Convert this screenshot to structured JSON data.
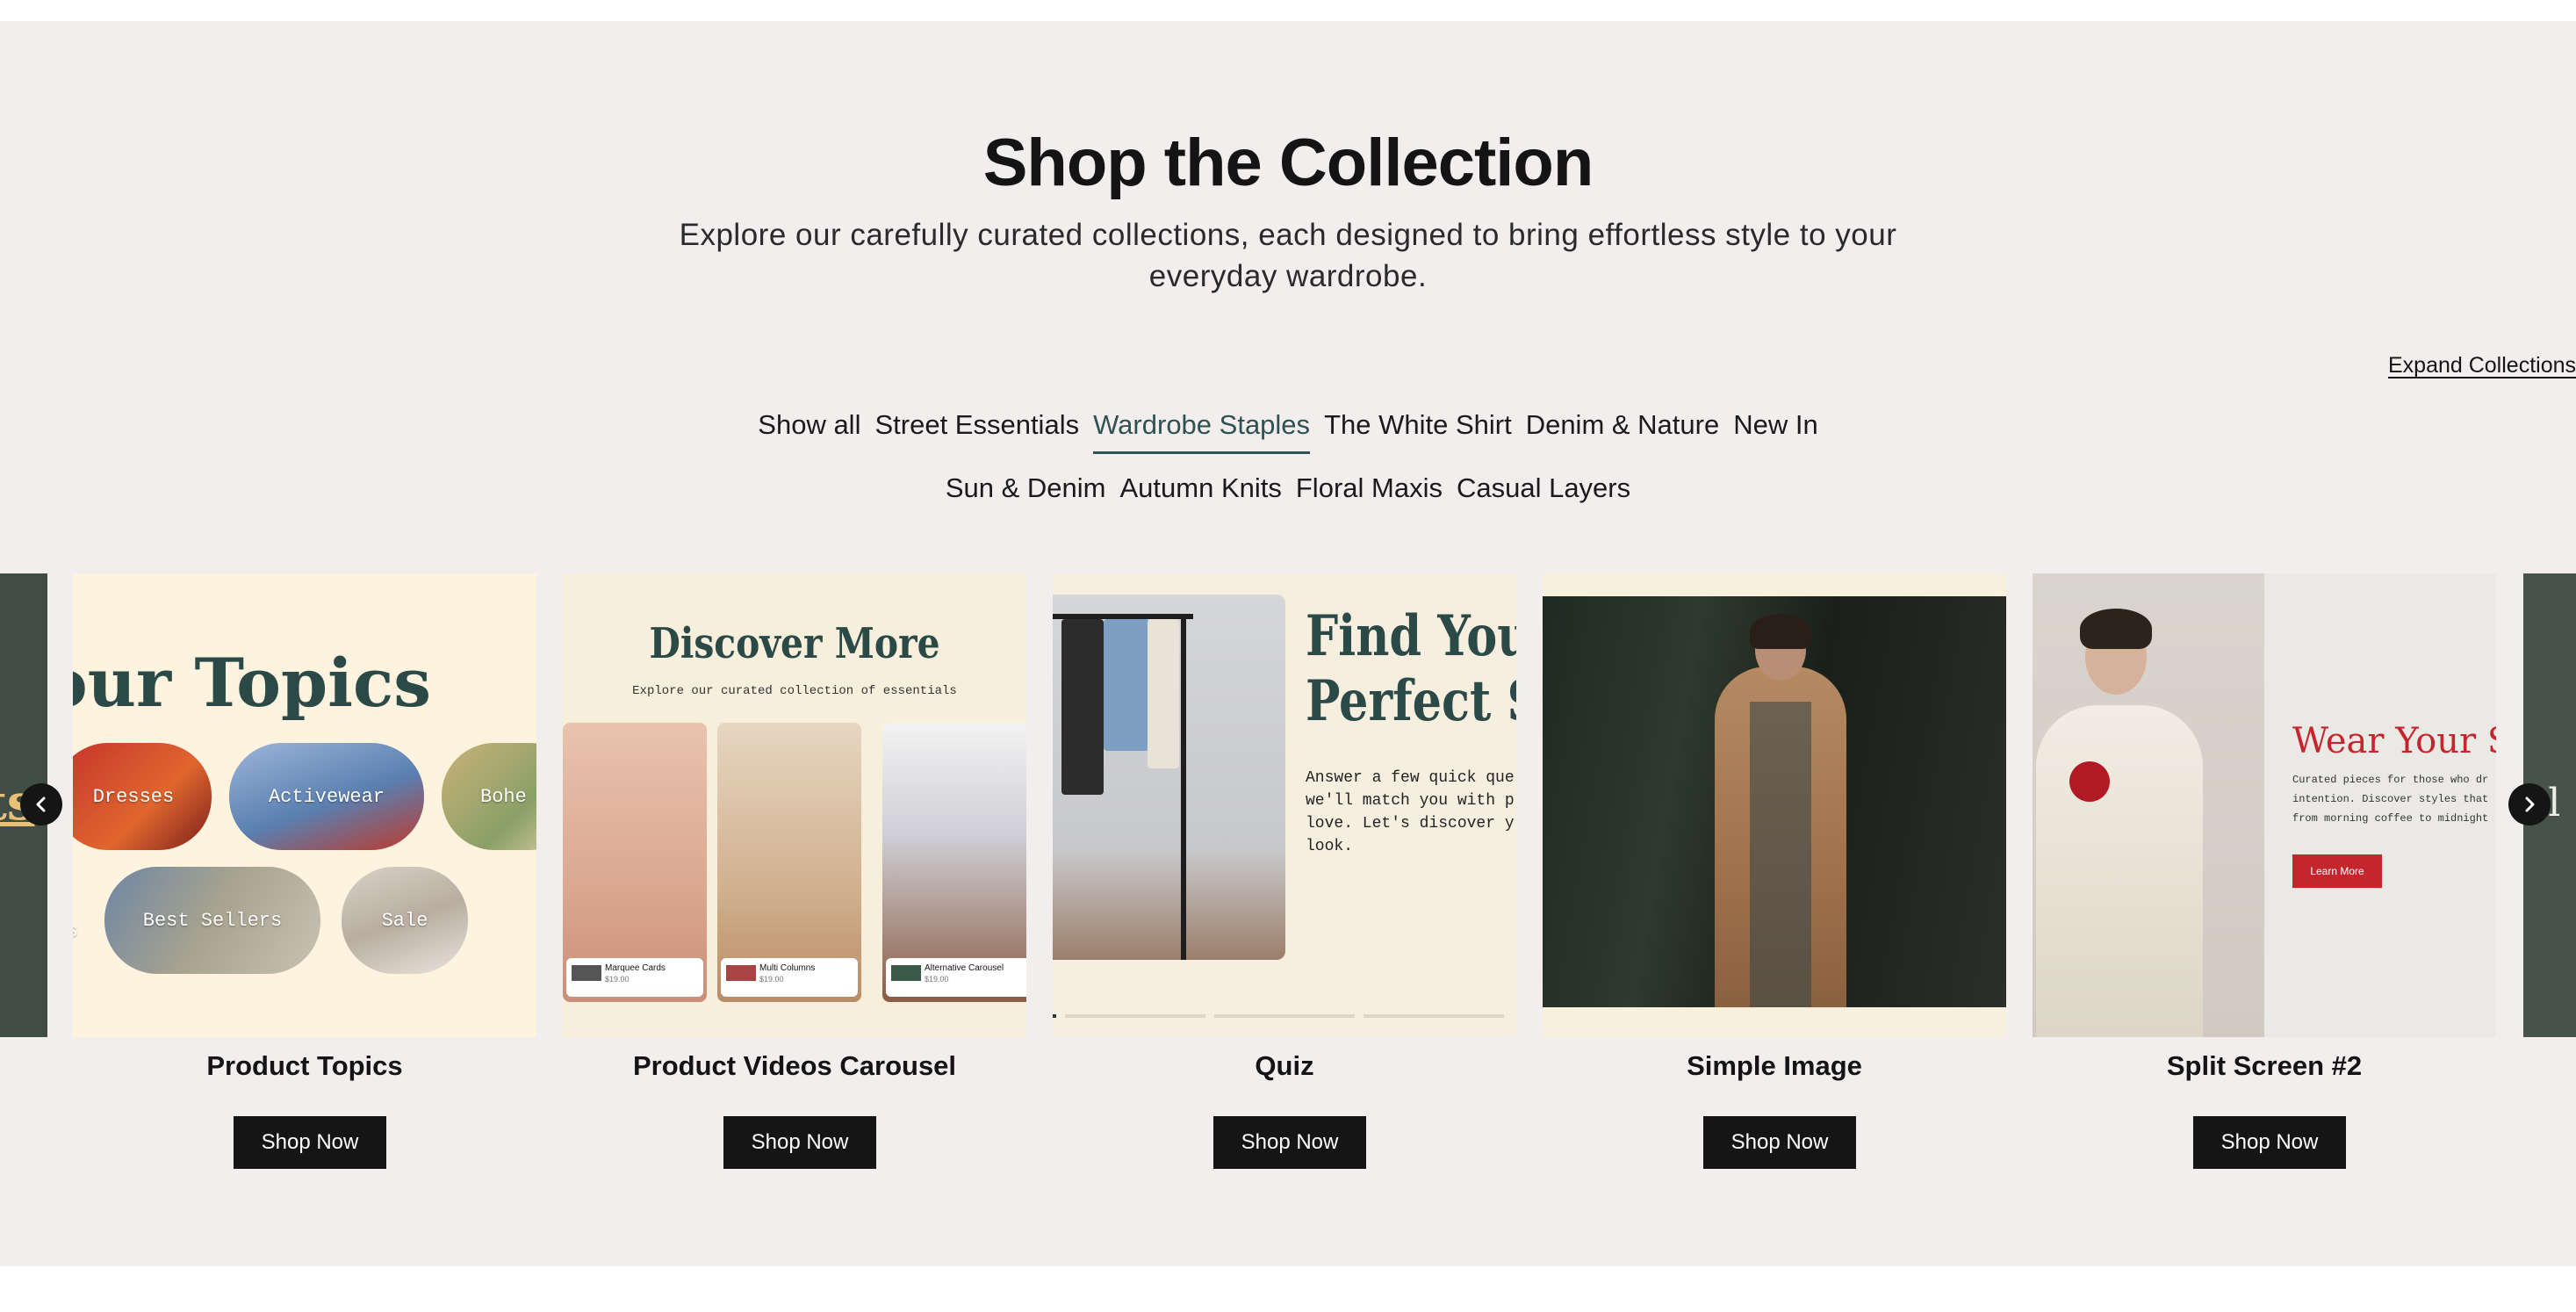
{
  "header": {
    "title": "Shop the Collection",
    "subtitle": "Explore our carefully curated collections, each designed to bring effortless style to your everyday wardrobe.",
    "expand_link": "Expand Collections"
  },
  "filters": {
    "row1": [
      "Show all",
      "Street Essentials",
      "Wardrobe Staples",
      "The White Shirt",
      "Denim & Nature",
      "New In"
    ],
    "row2": [
      "Sun & Denim",
      "Autumn Knits",
      "Floral Maxis",
      "Casual Layers"
    ],
    "active": "Wardrobe Staples"
  },
  "cards": [
    {
      "title": "Product Topics",
      "button": "Shop Now"
    },
    {
      "title": "Product Videos Carousel",
      "button": "Shop Now"
    },
    {
      "title": "Quiz",
      "button": "Shop Now"
    },
    {
      "title": "Simple Image",
      "button": "Shop Now"
    },
    {
      "title": "Split Screen #2",
      "button": "Shop Now"
    }
  ],
  "previews": {
    "topics": {
      "heading": "our Topics",
      "pills": [
        "Dresses",
        "Activewear",
        "Bohe",
        "Best Sellers",
        "Sale"
      ],
      "left_partial": "ts"
    },
    "videos": {
      "heading": "Discover More",
      "sub": "Explore our curated collection of essentials",
      "items": [
        {
          "name": "Marquee Cards",
          "price": "$19.00"
        },
        {
          "name": "Multi Columns",
          "price": "$19.00"
        },
        {
          "name": "Alternative Carousel",
          "price": "$19.00"
        }
      ]
    },
    "quiz": {
      "heading_line1": "Find Your",
      "heading_line2": "Perfect Sty",
      "body": "Answer a few quick que we'll match you with p love. Let's discover y look."
    },
    "split": {
      "heading": "Wear Your S",
      "body": "Curated pieces for those who dr intention. Discover styles that from morning coffee to midnight",
      "button": "Learn More"
    },
    "right_partial": "al S"
  },
  "icons": {
    "prev": "chevron-left-icon",
    "next": "chevron-right-icon"
  },
  "colors": {
    "section_bg": "#f1eeed",
    "active_tab": "#2f5152",
    "button_bg": "#151515",
    "accent_red": "#c4262e"
  }
}
